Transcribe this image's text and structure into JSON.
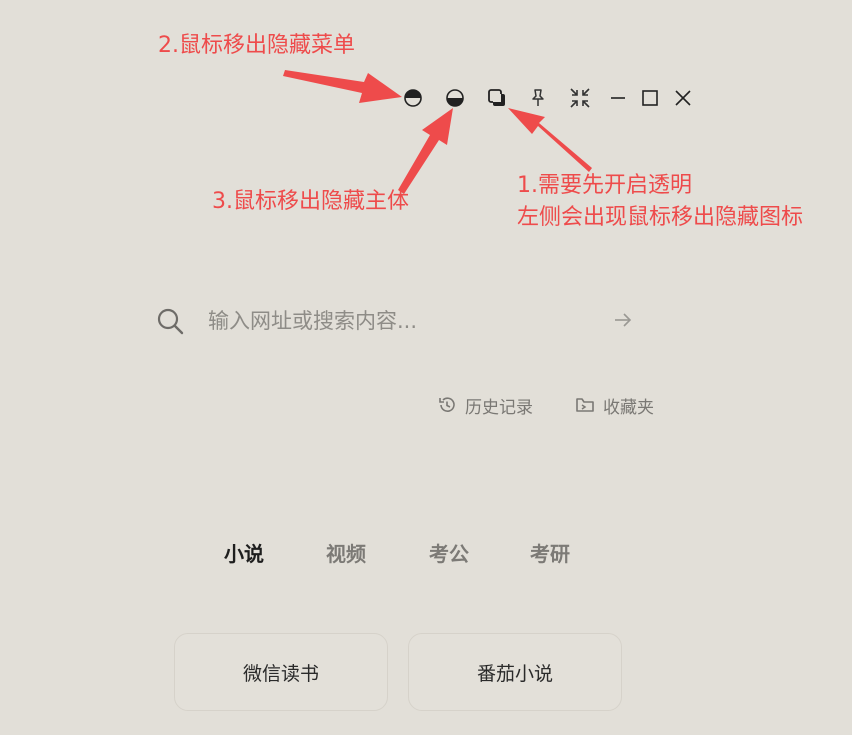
{
  "annotations": {
    "note_menu": "2.鼠标移出隐藏菜单",
    "note_body": "3.鼠标移出隐藏主体",
    "note_transparent_line1": "1.需要先开启透明",
    "note_transparent_line2": "左侧会出现鼠标移出隐藏图标",
    "color": "#ee4b4b"
  },
  "window_controls": [
    {
      "name": "hide-menu-on-leave",
      "icon": "half-circle-top-icon"
    },
    {
      "name": "hide-body-on-leave",
      "icon": "half-circle-bottom-icon"
    },
    {
      "name": "transparency",
      "icon": "transparency-icon"
    },
    {
      "name": "pin",
      "icon": "pin-icon"
    },
    {
      "name": "shrink",
      "icon": "shrink-icon"
    },
    {
      "name": "minimize",
      "icon": "minimize-icon"
    },
    {
      "name": "maximize",
      "icon": "maximize-icon"
    },
    {
      "name": "close",
      "icon": "close-icon"
    }
  ],
  "search": {
    "placeholder": "输入网址或搜索内容..."
  },
  "quick_links": {
    "history": "历史记录",
    "favorites": "收藏夹"
  },
  "tabs": [
    {
      "label": "小说",
      "active": true
    },
    {
      "label": "视频",
      "active": false
    },
    {
      "label": "考公",
      "active": false
    },
    {
      "label": "考研",
      "active": false
    }
  ],
  "cards": [
    {
      "label": "微信读书"
    },
    {
      "label": "番茄小说"
    }
  ],
  "colors": {
    "background": "#e2dfd8",
    "accent": "#ee4b4b"
  }
}
